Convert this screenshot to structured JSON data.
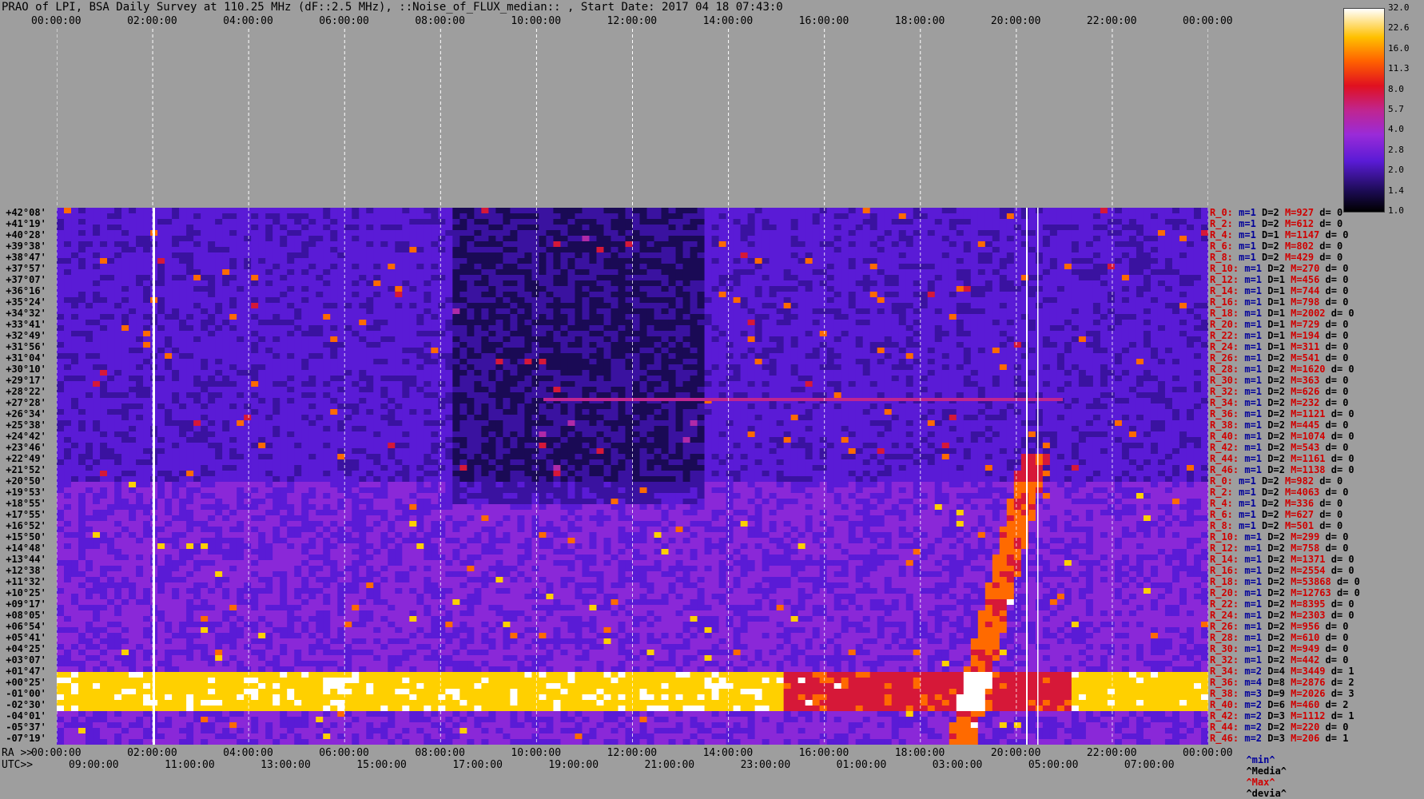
{
  "title": "PRAO of LPI, BSA Daily Survey at 110.25 MHz (dF::2.5 MHz), ::Noise_of_FLUX_median:: , Start Date: 2017 04 18 07:43:0",
  "top_axis_ticks": [
    "00:00:00",
    "02:00:00",
    "04:00:00",
    "06:00:00",
    "08:00:00",
    "10:00:00",
    "12:00:00",
    "14:00:00",
    "16:00:00",
    "18:00:00",
    "20:00:00",
    "22:00:00",
    "00:00:00"
  ],
  "bottom_axis": {
    "ra_prefix": "RA >>",
    "utc_prefix": "UTC>>",
    "ra_ticks": [
      "00:00:00",
      "02:00:00",
      "04:00:00",
      "06:00:00",
      "08:00:00",
      "10:00:00",
      "12:00:00",
      "14:00:00",
      "16:00:00",
      "18:00:00",
      "20:00:00",
      "22:00:00",
      "00:00:00"
    ],
    "utc_ticks": [
      "09:00:00",
      "11:00:00",
      "13:00:00",
      "15:00:00",
      "17:00:00",
      "19:00:00",
      "21:00:00",
      "23:00:00",
      "01:00:00",
      "03:00:00",
      "05:00:00",
      "07:00:00"
    ]
  },
  "colorbar": {
    "labels": [
      "32.0",
      "22.6",
      "16.0",
      "11.3",
      "8.0",
      "5.7",
      "4.0",
      "2.8",
      "2.0",
      "1.4",
      "1.0"
    ],
    "colors": [
      "#000000",
      "#1b0b52",
      "#5a1bd6",
      "#9a2bd8",
      "#c02590",
      "#e01020",
      "#ff6000",
      "#ffc000",
      "#ffffff"
    ]
  },
  "declinations": [
    "+42°08'",
    "+41°19'",
    "+40°28'",
    "+39°38'",
    "+38°47'",
    "+37°57'",
    "+37°07'",
    "+36°16'",
    "+35°24'",
    "+34°32'",
    "+33°41'",
    "+32°49'",
    "+31°56'",
    "+31°04'",
    "+30°10'",
    "+29°17'",
    "+28°22'",
    "+27°28'",
    "+26°34'",
    "+25°38'",
    "+24°42'",
    "+23°46'",
    "+22°49'",
    "+21°52'",
    "+20°50'",
    "+19°53'",
    "+18°55'",
    "+17°55'",
    "+16°52'",
    "+15°50'",
    "+14°48'",
    "+13°44'",
    "+12°38'",
    "+11°32'",
    "+10°25'",
    "+09°17'",
    "+08°05'",
    "+06°54'",
    "+05°41'",
    "+04°25'",
    "+03°07'",
    "+01°47'",
    "+00°25'",
    "-01°00'",
    "-02°30'",
    "-04°01'",
    "-05°37'",
    "-07°19'"
  ],
  "stats": [
    {
      "r": "R_0:",
      "m": "m=1",
      "d": "D=2",
      "big": "M=927",
      "dev": "d= 0"
    },
    {
      "r": "R_2:",
      "m": "m=1",
      "d": "D=2",
      "big": "M=612",
      "dev": "d= 0"
    },
    {
      "r": "R_4:",
      "m": "m=1",
      "d": "D=1",
      "big": "M=1147",
      "dev": "d= 0"
    },
    {
      "r": "R_6:",
      "m": "m=1",
      "d": "D=2",
      "big": "M=802",
      "dev": "d= 0"
    },
    {
      "r": "R_8:",
      "m": "m=1",
      "d": "D=2",
      "big": "M=429",
      "dev": "d= 0"
    },
    {
      "r": "R_10:",
      "m": "m=1",
      "d": "D=2",
      "big": "M=270",
      "dev": "d= 0"
    },
    {
      "r": "R_12:",
      "m": "m=1",
      "d": "D=1",
      "big": "M=456",
      "dev": "d= 0"
    },
    {
      "r": "R_14:",
      "m": "m=1",
      "d": "D=1",
      "big": "M=744",
      "dev": "d= 0"
    },
    {
      "r": "R_16:",
      "m": "m=1",
      "d": "D=1",
      "big": "M=798",
      "dev": "d= 0"
    },
    {
      "r": "R_18:",
      "m": "m=1",
      "d": "D=1",
      "big": "M=2002",
      "dev": "d= 0"
    },
    {
      "r": "R_20:",
      "m": "m=1",
      "d": "D=1",
      "big": "M=729",
      "dev": "d= 0"
    },
    {
      "r": "R_22:",
      "m": "m=1",
      "d": "D=1",
      "big": "M=194",
      "dev": "d= 0"
    },
    {
      "r": "R_24:",
      "m": "m=1",
      "d": "D=1",
      "big": "M=311",
      "dev": "d= 0"
    },
    {
      "r": "R_26:",
      "m": "m=1",
      "d": "D=2",
      "big": "M=541",
      "dev": "d= 0"
    },
    {
      "r": "R_28:",
      "m": "m=1",
      "d": "D=2",
      "big": "M=1620",
      "dev": "d= 0"
    },
    {
      "r": "R_30:",
      "m": "m=1",
      "d": "D=2",
      "big": "M=363",
      "dev": "d= 0"
    },
    {
      "r": "R_32:",
      "m": "m=1",
      "d": "D=2",
      "big": "M=626",
      "dev": "d= 0"
    },
    {
      "r": "R_34:",
      "m": "m=1",
      "d": "D=2",
      "big": "M=232",
      "dev": "d= 0"
    },
    {
      "r": "R_36:",
      "m": "m=1",
      "d": "D=2",
      "big": "M=1121",
      "dev": "d= 0"
    },
    {
      "r": "R_38:",
      "m": "m=1",
      "d": "D=2",
      "big": "M=445",
      "dev": "d= 0"
    },
    {
      "r": "R_40:",
      "m": "m=1",
      "d": "D=2",
      "big": "M=1074",
      "dev": "d= 0"
    },
    {
      "r": "R_42:",
      "m": "m=1",
      "d": "D=2",
      "big": "M=543",
      "dev": "d= 0"
    },
    {
      "r": "R_44:",
      "m": "m=1",
      "d": "D=2",
      "big": "M=1161",
      "dev": "d= 0"
    },
    {
      "r": "R_46:",
      "m": "m=1",
      "d": "D=2",
      "big": "M=1138",
      "dev": "d= 0"
    },
    {
      "r": "R_0:",
      "m": "m=1",
      "d": "D=2",
      "big": "M=982",
      "dev": "d= 0"
    },
    {
      "r": "R_2:",
      "m": "m=1",
      "d": "D=2",
      "big": "M=4063",
      "dev": "d= 0"
    },
    {
      "r": "R_4:",
      "m": "m=1",
      "d": "D=2",
      "big": "M=336",
      "dev": "d= 0"
    },
    {
      "r": "R_6:",
      "m": "m=1",
      "d": "D=2",
      "big": "M=627",
      "dev": "d= 0"
    },
    {
      "r": "R_8:",
      "m": "m=1",
      "d": "D=2",
      "big": "M=501",
      "dev": "d= 0"
    },
    {
      "r": "R_10:",
      "m": "m=1",
      "d": "D=2",
      "big": "M=299",
      "dev": "d= 0"
    },
    {
      "r": "R_12:",
      "m": "m=1",
      "d": "D=2",
      "big": "M=758",
      "dev": "d= 0"
    },
    {
      "r": "R_14:",
      "m": "m=1",
      "d": "D=2",
      "big": "M=1371",
      "dev": "d= 0"
    },
    {
      "r": "R_16:",
      "m": "m=1",
      "d": "D=2",
      "big": "M=2554",
      "dev": "d= 0"
    },
    {
      "r": "R_18:",
      "m": "m=1",
      "d": "D=2",
      "big": "M=53868",
      "dev": "d= 0"
    },
    {
      "r": "R_20:",
      "m": "m=1",
      "d": "D=2",
      "big": "M=12763",
      "dev": "d= 0"
    },
    {
      "r": "R_22:",
      "m": "m=1",
      "d": "D=2",
      "big": "M=8395",
      "dev": "d= 0"
    },
    {
      "r": "R_24:",
      "m": "m=1",
      "d": "D=2",
      "big": "M=2303",
      "dev": "d= 0"
    },
    {
      "r": "R_26:",
      "m": "m=1",
      "d": "D=2",
      "big": "M=956",
      "dev": "d= 0"
    },
    {
      "r": "R_28:",
      "m": "m=1",
      "d": "D=2",
      "big": "M=610",
      "dev": "d= 0"
    },
    {
      "r": "R_30:",
      "m": "m=1",
      "d": "D=2",
      "big": "M=949",
      "dev": "d= 0"
    },
    {
      "r": "R_32:",
      "m": "m=1",
      "d": "D=2",
      "big": "M=442",
      "dev": "d= 0"
    },
    {
      "r": "R_34:",
      "m": "m=2",
      "d": "D=4",
      "big": "M=3449",
      "dev": "d= 1"
    },
    {
      "r": "R_36:",
      "m": "m=4",
      "d": "D=8",
      "big": "M=2876",
      "dev": "d= 2"
    },
    {
      "r": "R_38:",
      "m": "m=3",
      "d": "D=9",
      "big": "M=2026",
      "dev": "d= 3"
    },
    {
      "r": "R_40:",
      "m": "m=2",
      "d": "D=6",
      "big": "M=460",
      "dev": "d= 2"
    },
    {
      "r": "R_42:",
      "m": "m=2",
      "d": "D=3",
      "big": "M=1112",
      "dev": "d= 1"
    },
    {
      "r": "R_44:",
      "m": "m=2",
      "d": "D=2",
      "big": "M=220",
      "dev": "d= 0"
    },
    {
      "r": "R_46:",
      "m": "m=2",
      "d": "D=3",
      "big": "M=206",
      "dev": "d= 1"
    }
  ],
  "legend_footer": {
    "min": "^min^",
    "median": "^Media^",
    "max": "^Max^",
    "dev": "^devia^"
  },
  "chart_data": {
    "type": "heatmap",
    "title": "PRAO of LPI, BSA Daily Survey at 110.25 MHz (dF::2.5 MHz), ::Noise_of_FLUX_median:: , Start Date: 2017 04 18 07:43:0",
    "x_axis_top": "Sidereal time 00:00:00 – 00:00:00",
    "x_axis_bottom_utc": "09:00:00 – 07:00:00",
    "y_axis": "Declination +42°08' to -07°19'",
    "colorbar_range": [
      1.0,
      32.0
    ],
    "colorbar_scale": "log"
  }
}
